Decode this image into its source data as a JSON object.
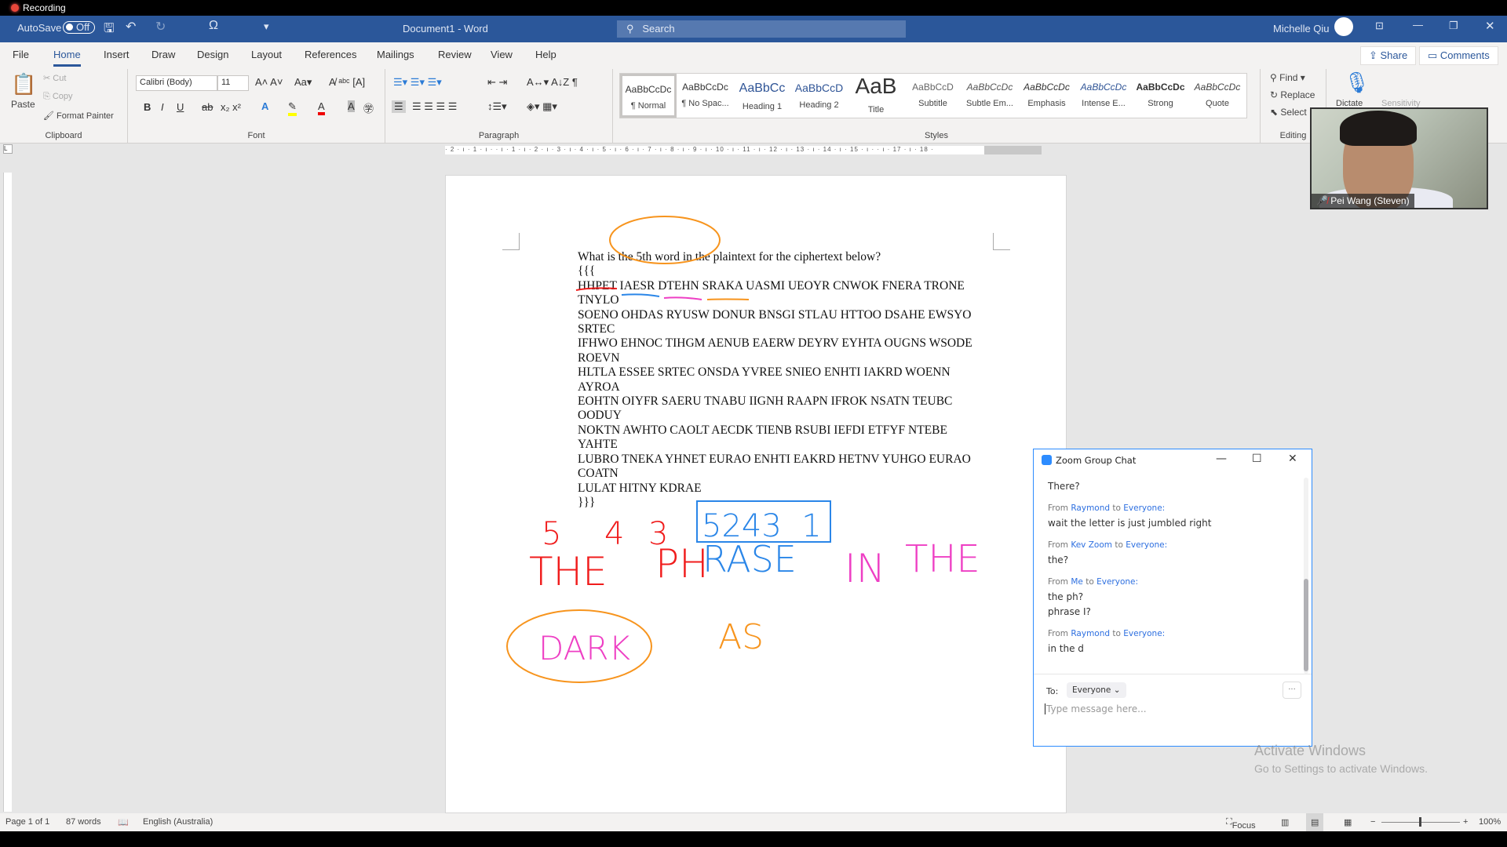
{
  "recording": {
    "label": "Recording"
  },
  "titlebar": {
    "autosave_label": "AutoSave",
    "autosave_state": "Off",
    "doc_title": "Document1  -  Word",
    "search_placeholder": "Search",
    "user_name": "Michelle Qiu"
  },
  "tabs": [
    "File",
    "Home",
    "Insert",
    "Draw",
    "Design",
    "Layout",
    "References",
    "Mailings",
    "Review",
    "View",
    "Help"
  ],
  "share_label": "Share",
  "comments_label": "Comments",
  "ribbon": {
    "clipboard": {
      "paste": "Paste",
      "cut": "Cut",
      "copy": "Copy",
      "format_painter": "Format Painter",
      "label": "Clipboard"
    },
    "font": {
      "name": "Calibri (Body)",
      "size": "11",
      "label": "Font"
    },
    "paragraph": {
      "label": "Paragraph"
    },
    "styles": {
      "label": "Styles",
      "items": [
        {
          "preview": "AaBbCcDc",
          "name": "¶ Normal"
        },
        {
          "preview": "AaBbCcDc",
          "name": "¶ No Spac..."
        },
        {
          "preview": "AaBbCc",
          "name": "Heading 1"
        },
        {
          "preview": "AaBbCcD",
          "name": "Heading 2"
        },
        {
          "preview": "AaB",
          "name": "Title"
        },
        {
          "preview": "AaBbCcD",
          "name": "Subtitle"
        },
        {
          "preview": "AaBbCcDc",
          "name": "Subtle Em..."
        },
        {
          "preview": "AaBbCcDc",
          "name": "Emphasis"
        },
        {
          "preview": "AaBbCcDc",
          "name": "Intense E..."
        },
        {
          "preview": "AaBbCcDc",
          "name": "Strong"
        },
        {
          "preview": "AaBbCcDc",
          "name": "Quote"
        }
      ]
    },
    "editing": {
      "find": "Find",
      "replace": "Replace",
      "select": "Select",
      "label": "Editing"
    },
    "dictate": "Dictate",
    "sensitivity": "Sensitivity"
  },
  "ruler": {
    "marks": "· 2 · ı · 1 · ı ·   · ı · 1 · ı · 2 · ı · 3 · ı · 4 · ı · 5 · ı · 6 · ı · 7 · ı · 8 · ı · 9 · ı · 10 · ı · 11 · ı · 12 · ı · 13 · ı · 14 · ı · 15 · ı ·   · ı · 17 · ı · 18 ·"
  },
  "document": {
    "lines": [
      "What is the 5th word in the plaintext for the ciphertext below?",
      "{{{",
      "HHPET IAESR DTEHN SRAKA UASMI UEOYR CNWOK FNERA TRONE",
      "TNYLO",
      "SOENO OHDAS RYUSW DONUR BNSGI STLAU HTTOO DSAHE EWSYO",
      "SRTEC",
      "IFHWO EHNOC TIHGM AENUB EAERW DEYRV EYHTA OUGNS WSODE",
      "ROEVN",
      "HLTLA ESSEE SRTEC ONSDA YVREE SNIEO ENHTI IAKRD WOENN",
      "AYROA",
      "EOHTN OIYFR SAERU TNABU IIGNH RAAPN IFROK NSATN TEUBC",
      "OODUY",
      "NOKTN AWHTO CAOLT AECDK TIENB RSUBI IEFDI ETFYF NTEBE",
      "YAHTE",
      "LUBRO TNEKA YHNET EURAO ENHTI EAKRD HETNV YUHGO EURAO",
      "COATN",
      "LULAT HITNY KDRAE",
      "}}}"
    ]
  },
  "annotations": {
    "red_numbers": [
      "5",
      "4",
      "3"
    ],
    "blue_numbers": "5243  1",
    "the": "THE",
    "ph": "PH",
    "rase": "RASE",
    "in": "IN",
    "the2": "THE",
    "dark": "DARK",
    "as": "AS",
    "colors": {
      "red": "#f01c1c",
      "blue": "#2a86e8",
      "pink": "#ee3fc4",
      "orange": "#f7941d"
    }
  },
  "video": {
    "participant": "Pei Wang (Steven)"
  },
  "chat": {
    "title": "Zoom Group Chat",
    "messages": [
      {
        "text": [
          "There?"
        ]
      },
      {
        "from": "Raymond",
        "to": "Everyone:",
        "text": [
          "wait the letter is just jumbled right"
        ]
      },
      {
        "from": "Kev Zoom",
        "to": "Everyone:",
        "text": [
          "the?"
        ]
      },
      {
        "from": "Me",
        "to": "Everyone:",
        "text": [
          "the ph?",
          "phrase I?"
        ]
      },
      {
        "from": "Raymond",
        "to": "Everyone:",
        "text": [
          "in the d"
        ]
      }
    ],
    "from_word": "From",
    "to_word": "to",
    "to_label": "To:",
    "recipient": "Everyone",
    "placeholder": "Type message here...",
    "more": "···"
  },
  "statusbar": {
    "page": "Page 1 of 1",
    "words": "87 words",
    "language": "English (Australia)",
    "focus": "Focus",
    "zoom": "100%"
  },
  "watermark": {
    "title": "Activate Windows",
    "subtitle": "Go to Settings to activate Windows."
  }
}
